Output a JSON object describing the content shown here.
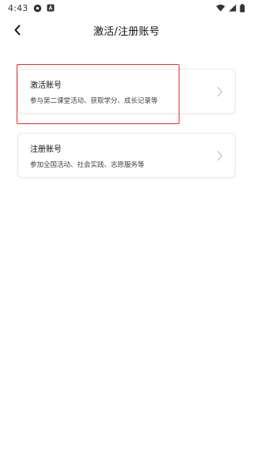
{
  "status_bar": {
    "time": "4:43",
    "icons_left": [
      "soccer-ball-icon",
      "notification-a-icon"
    ],
    "icons_right": [
      "wifi-icon",
      "cell-signal-icon",
      "battery-icon"
    ]
  },
  "header": {
    "title": "激活/注册账号",
    "back_icon": "chevron-left-icon"
  },
  "cards": [
    {
      "title": "激活账号",
      "description": "参与第二课堂活动、获取学分、成长记录等"
    },
    {
      "title": "注册账号",
      "description": "参加全国活动、社会实践、志愿服务等"
    }
  ],
  "colors": {
    "highlight": "#e52b2b",
    "card_border": "#e9e9e9",
    "chevron": "#c8c8c8"
  }
}
